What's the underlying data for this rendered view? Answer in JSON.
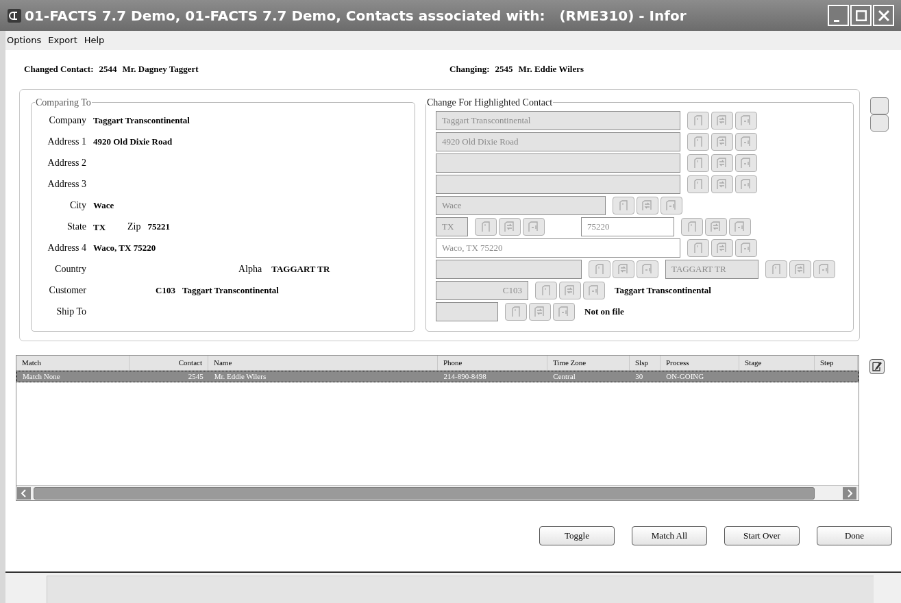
{
  "window": {
    "title": "01-FACTS 7.7 Demo, 01-FACTS 7.7 Demo, Contacts associated with:   (RME310) - Infor"
  },
  "menu": [
    "Options",
    "Export",
    "Help"
  ],
  "header": [
    {
      "label": "Changed Contact:",
      "number": "2544",
      "name": "Mr. Dagney Taggert"
    },
    {
      "label": "Changing:",
      "number": "2545",
      "name": "Mr. Eddie Wilers"
    }
  ],
  "comparing_to": {
    "title": "Comparing To",
    "rows": [
      {
        "kind": "single",
        "label": "Company",
        "value": "Taggart Transcontinental"
      },
      {
        "kind": "single",
        "label": "Address 1",
        "value": "4920 Old Dixie Road"
      },
      {
        "kind": "single",
        "label": "Address 2"
      },
      {
        "kind": "single",
        "label": "Address 3"
      },
      {
        "kind": "single",
        "label": "City",
        "value": "Wace"
      },
      {
        "kind": "pair",
        "label": "State",
        "value": "TX",
        "label2": "Zip",
        "value2": "75221"
      },
      {
        "kind": "single",
        "label": "Address 4",
        "value": "Waco, TX 75220"
      },
      {
        "kind": "alpha",
        "label": "Country",
        "label2": "Alpha",
        "value2": "TAGGART TR"
      },
      {
        "kind": "customer",
        "label": "Customer",
        "code": "C103",
        "value": "Taggart Transcontinental"
      },
      {
        "kind": "single",
        "label": "Ship To"
      }
    ]
  },
  "change_for": {
    "title": "Change For Highlighted Contact",
    "rows": [
      {
        "kind": "wide",
        "fields": [
          {
            "value": "Taggart Transcontinental",
            "disabled": true
          }
        ]
      },
      {
        "kind": "wide",
        "fields": [
          {
            "value": "4920 Old Dixie Road",
            "disabled": true
          }
        ]
      },
      {
        "kind": "wide",
        "fields": [
          {
            "disabled": true
          }
        ]
      },
      {
        "kind": "wide",
        "fields": [
          {
            "disabled": true
          }
        ]
      },
      {
        "kind": "medium",
        "fields": [
          {
            "value": "Wace",
            "disabled": true
          }
        ]
      },
      {
        "kind": "pair",
        "fields": [
          {
            "value": "TX",
            "disabled": true
          },
          {
            "value": "75220",
            "disabled": false
          }
        ]
      },
      {
        "kind": "wide",
        "fields": [
          {
            "value": "Waco, TX 75220",
            "disabled": false
          }
        ]
      },
      {
        "kind": "alpha",
        "fields": [
          {
            "disabled": true
          },
          {
            "value": "TAGGART TR",
            "disabled": true
          }
        ]
      },
      {
        "kind": "customer",
        "fields": [
          {
            "value": "C103",
            "disabled": true
          }
        ],
        "note": "Taggart Transcontinental"
      },
      {
        "kind": "shipto",
        "fields": [
          {
            "disabled": true
          }
        ],
        "note": "Not on file"
      }
    ]
  },
  "table": {
    "columns": [
      "Match",
      "Contact",
      "Name",
      "Phone",
      "Time Zone",
      "Slsp",
      "Process",
      "Stage",
      "Step"
    ],
    "rows": [
      {
        "selected": true,
        "cells": [
          "Match None",
          "2545",
          "Mr. Eddie Wilers",
          "214-890-8498",
          "Central",
          "30",
          "ON-GOING",
          "",
          ""
        ]
      }
    ]
  },
  "buttons": [
    "Toggle",
    "Match All",
    "Start Over",
    "Done"
  ]
}
